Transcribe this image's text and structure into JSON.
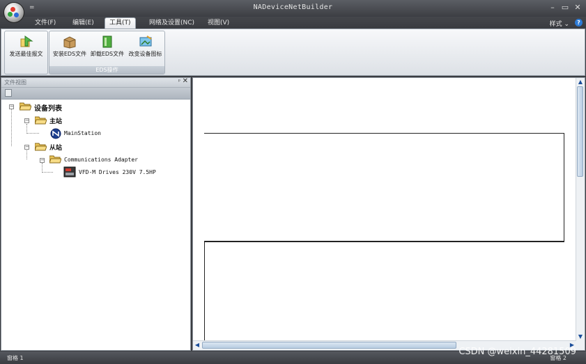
{
  "window": {
    "title": "NADeviceNetBuilder",
    "qat": "=",
    "minimize": "–",
    "maximize": "▭",
    "close": "✕"
  },
  "menu": {
    "tabs": [
      "文件(F)",
      "编辑(E)",
      "工具(T)",
      "网络及设置(NC)",
      "视图(V)"
    ],
    "active_tab": "工具(T)",
    "style_label": "样式 ⌄",
    "help": "?"
  },
  "ribbon": {
    "group1": {
      "buttons": [
        "发送最佳报文"
      ]
    },
    "group2": {
      "label": "EDS操作",
      "buttons": [
        "安装EDS文件",
        "卸载EDS文件",
        "改变设备图标"
      ]
    }
  },
  "left_panel": {
    "title": "文件视图",
    "pin": "ᵖ",
    "close": "✕",
    "tree": {
      "root": "设备列表",
      "master": "主站",
      "master_child": "MainStation",
      "slave": "从站",
      "adapter": "Communications Adapter",
      "device": "VFD-M Drives 230V 7.5HP"
    }
  },
  "status": {
    "left": "窗格 1",
    "right": "窗格 2"
  },
  "watermark": "CSDN @weixin_44281509",
  "colors": {
    "chrome_dark": "#3c3e43",
    "ribbon_light": "#f7f8fa",
    "scroll_accent": "#b9cde2"
  }
}
